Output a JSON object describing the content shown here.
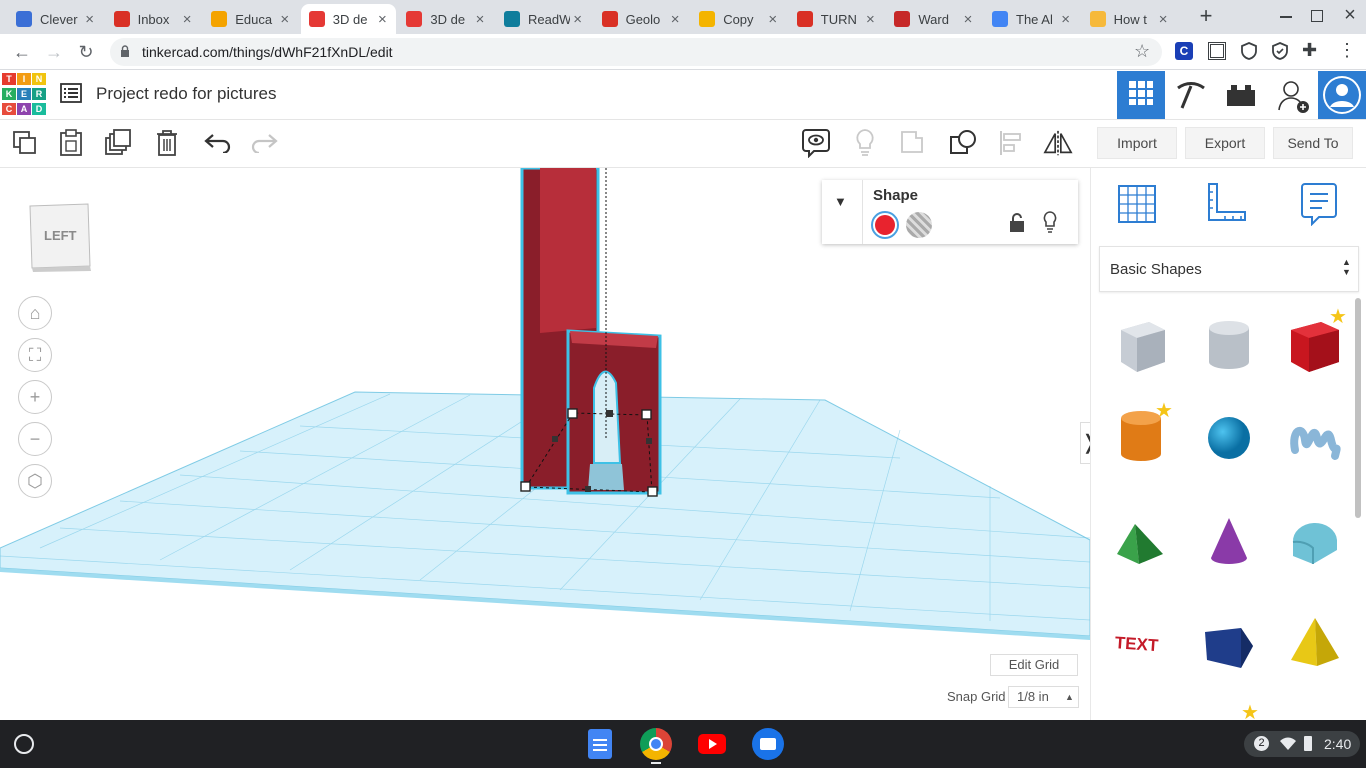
{
  "browser": {
    "tabs": [
      {
        "title": "Clever",
        "favicon": "clever-icon",
        "color": "#3b6fd6"
      },
      {
        "title": "Inbox",
        "favicon": "gmail-icon",
        "color": "#d93025"
      },
      {
        "title": "Educa",
        "favicon": "edpuzzle-icon",
        "color": "#f4a300"
      },
      {
        "title": "3D de",
        "favicon": "tinkercad-icon",
        "color": "#e53935",
        "active": true
      },
      {
        "title": "3D de",
        "favicon": "tinkercad-icon",
        "color": "#e53935"
      },
      {
        "title": "ReadW",
        "favicon": "readworks-icon",
        "color": "#0f7d9c"
      },
      {
        "title": "Geolo",
        "favicon": "ring-icon",
        "color": "#d93025"
      },
      {
        "title": "Copy",
        "favicon": "slides-icon",
        "color": "#f4b400"
      },
      {
        "title": "TURN",
        "favicon": "ring-icon",
        "color": "#d93025"
      },
      {
        "title": "Ward",
        "favicon": "ward-icon",
        "color": "#c62828"
      },
      {
        "title": "The Al",
        "favicon": "docs-icon",
        "color": "#4285f4"
      },
      {
        "title": "How t",
        "favicon": "face-icon",
        "color": "#f6b93b"
      }
    ],
    "url": "tinkercad.com/things/dWhF21fXnDL/edit"
  },
  "header": {
    "logo_letters": [
      "T",
      "I",
      "N",
      "K",
      "E",
      "R",
      "C",
      "A",
      "D"
    ],
    "project_title": "Project redo for pictures"
  },
  "toolbar": {
    "import_label": "Import",
    "export_label": "Export",
    "send_to_label": "Send To"
  },
  "viewcube": {
    "face_label": "LEFT"
  },
  "inspector": {
    "title": "Shape",
    "solid_color": "#e8232e"
  },
  "library": {
    "category": "Basic Shapes"
  },
  "grid": {
    "edit_grid_label": "Edit Grid",
    "snap_grid_label": "Snap Grid",
    "snap_value": "1/8 in"
  },
  "shelf": {
    "notification_count": "2",
    "time": "2:40"
  }
}
